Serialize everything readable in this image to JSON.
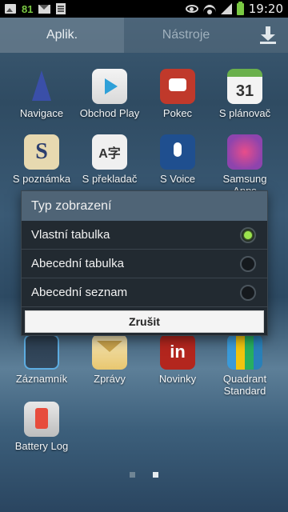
{
  "status_bar": {
    "notification_count": "81",
    "time": "19:20",
    "icons": [
      "gallery-icon",
      "mail-icon",
      "document-icon",
      "eye-icon",
      "wifi-icon",
      "signal-icon",
      "battery-icon"
    ]
  },
  "tabs": [
    {
      "label": "Aplik.",
      "active": true
    },
    {
      "label": "Nástroje",
      "active": false
    }
  ],
  "apps": [
    {
      "label": "Navigace",
      "icon": "navigation-icon"
    },
    {
      "label": "Obchod Play",
      "icon": "play-store-icon"
    },
    {
      "label": "Pokec",
      "icon": "chat-icon"
    },
    {
      "label": "S plánovač",
      "icon": "calendar-icon",
      "icon_text": "31"
    },
    {
      "label": "S poznámka",
      "icon": "memo-icon",
      "icon_text": "S"
    },
    {
      "label": "S překladač",
      "icon": "translator-icon",
      "icon_text": "A字"
    },
    {
      "label": "S Voice",
      "icon": "microphone-icon"
    },
    {
      "label": "Samsung Apps",
      "icon": "samsung-apps-icon"
    },
    {
      "label": "Záznamník",
      "icon": "recorder-icon"
    },
    {
      "label": "Zprávy",
      "icon": "messages-icon"
    },
    {
      "label": "Novinky",
      "icon": "linkedin-icon",
      "icon_text": "in"
    },
    {
      "label": "Quadrant Standard",
      "icon": "quadrant-icon"
    },
    {
      "label": "Battery Log",
      "icon": "battery-log-icon"
    }
  ],
  "dialog": {
    "title": "Typ zobrazení",
    "options": [
      {
        "label": "Vlastní tabulka",
        "selected": true
      },
      {
        "label": "Abecední tabulka",
        "selected": false
      },
      {
        "label": "Abecední seznam",
        "selected": false
      }
    ],
    "cancel_label": "Zrušit",
    "selected_color": "#9be34d"
  },
  "page_indicator": {
    "pages": 2,
    "current": 2
  }
}
